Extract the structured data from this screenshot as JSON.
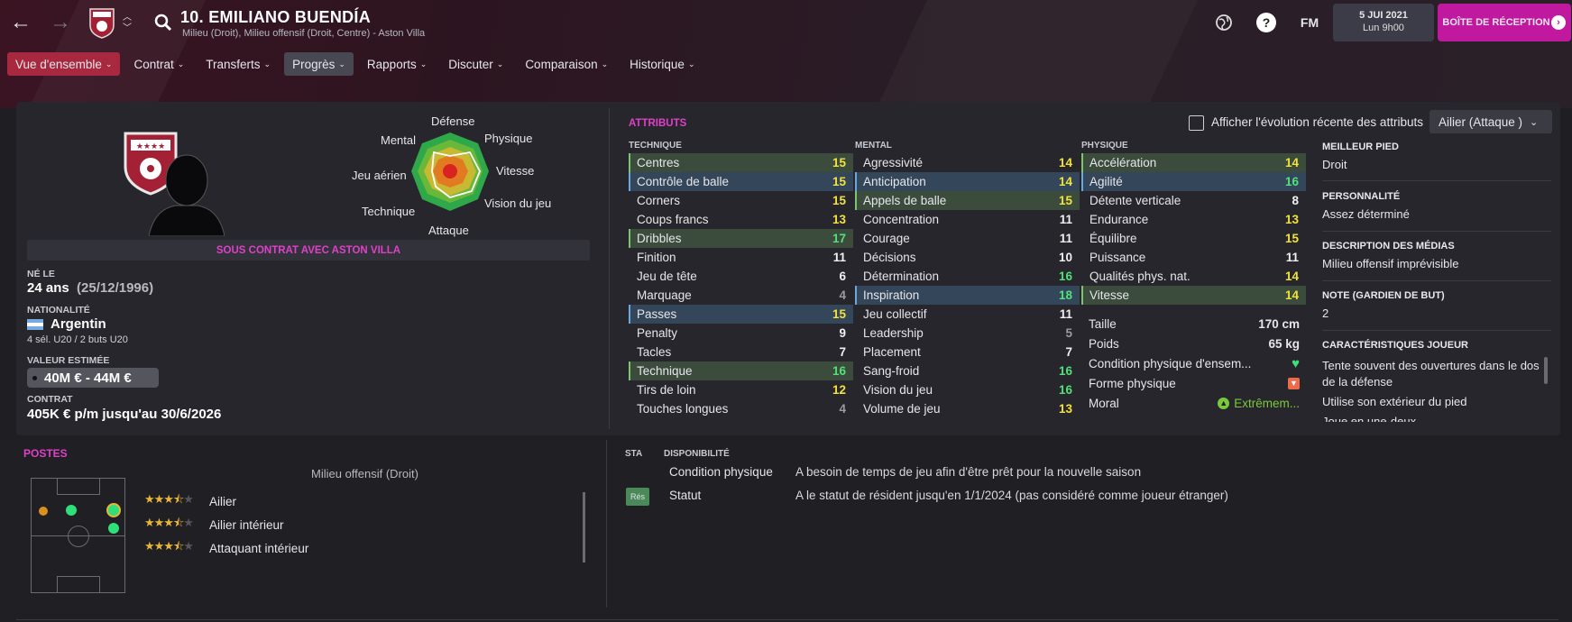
{
  "header": {
    "player_title": "10. EMILIANO BUENDÍA",
    "player_subtitle": "Milieu (Droit), Milieu offensif (Droit, Centre) - Aston Villa",
    "fm_label": "FM",
    "date": "5 JUI 2021",
    "time": "Lun 9h00",
    "inbox_label": "BOÎTE DE RÉCEPTION",
    "help_label": "?"
  },
  "nav": {
    "tabs": [
      {
        "label": "Vue d'ensemble"
      },
      {
        "label": "Contrat"
      },
      {
        "label": "Transferts"
      },
      {
        "label": "Progrès"
      },
      {
        "label": "Rapports"
      },
      {
        "label": "Discuter"
      },
      {
        "label": "Comparaison"
      },
      {
        "label": "Historique"
      }
    ]
  },
  "radar": {
    "labels": [
      "Défense",
      "Physique",
      "Vitesse",
      "Vision du jeu",
      "Attaque",
      "Technique",
      "Jeu aérien",
      "Mental"
    ]
  },
  "profile": {
    "contract_banner": "SOUS CONTRAT AVEC ASTON VILLA",
    "born_label": "NÉ LE",
    "age": "24 ans",
    "dob": "(25/12/1996)",
    "nationality_label": "NATIONALITÉ",
    "nationality": "Argentin",
    "caps": "4 sél. U20 / 2 buts U20",
    "value_label": "VALEUR ESTIMÉE",
    "value": "40M € - 44M €",
    "contract_label": "CONTRAT",
    "contract": "405K € p/m jusqu'au 30/6/2026"
  },
  "attributes": {
    "title": "ATTRIBUTS",
    "show_evolution_label": "Afficher l'évolution récente des attributs",
    "role_select": "Ailier (Attaque )",
    "technique_head": "TECHNIQUE",
    "mental_head": "MENTAL",
    "physique_head": "PHYSIQUE",
    "technique": [
      {
        "name": "Centres",
        "value": "15",
        "hl": "green"
      },
      {
        "name": "Contrôle de balle",
        "value": "15",
        "hl": "blue"
      },
      {
        "name": "Corners",
        "value": "15",
        "hl": ""
      },
      {
        "name": "Coups francs",
        "value": "13",
        "hl": ""
      },
      {
        "name": "Dribbles",
        "value": "17",
        "hl": "green"
      },
      {
        "name": "Finition",
        "value": "11",
        "hl": ""
      },
      {
        "name": "Jeu de tête",
        "value": "6",
        "hl": ""
      },
      {
        "name": "Marquage",
        "value": "4",
        "hl": ""
      },
      {
        "name": "Passes",
        "value": "15",
        "hl": "blue"
      },
      {
        "name": "Penalty",
        "value": "9",
        "hl": ""
      },
      {
        "name": "Tacles",
        "value": "7",
        "hl": ""
      },
      {
        "name": "Technique",
        "value": "16",
        "hl": "green"
      },
      {
        "name": "Tirs de loin",
        "value": "12",
        "hl": ""
      },
      {
        "name": "Touches longues",
        "value": "4",
        "hl": ""
      }
    ],
    "mental": [
      {
        "name": "Agressivité",
        "value": "14",
        "hl": ""
      },
      {
        "name": "Anticipation",
        "value": "14",
        "hl": "blue"
      },
      {
        "name": "Appels de balle",
        "value": "15",
        "hl": "green"
      },
      {
        "name": "Concentration",
        "value": "11",
        "hl": ""
      },
      {
        "name": "Courage",
        "value": "11",
        "hl": ""
      },
      {
        "name": "Décisions",
        "value": "10",
        "hl": ""
      },
      {
        "name": "Détermination",
        "value": "16",
        "hl": ""
      },
      {
        "name": "Inspiration",
        "value": "18",
        "hl": "blue"
      },
      {
        "name": "Jeu collectif",
        "value": "11",
        "hl": ""
      },
      {
        "name": "Leadership",
        "value": "5",
        "hl": ""
      },
      {
        "name": "Placement",
        "value": "7",
        "hl": ""
      },
      {
        "name": "Sang-froid",
        "value": "16",
        "hl": ""
      },
      {
        "name": "Vision du jeu",
        "value": "16",
        "hl": ""
      },
      {
        "name": "Volume de jeu",
        "value": "13",
        "hl": ""
      }
    ],
    "physique": [
      {
        "name": "Accélération",
        "value": "14",
        "hl": "green"
      },
      {
        "name": "Agilité",
        "value": "16",
        "hl": "blue"
      },
      {
        "name": "Détente verticale",
        "value": "8",
        "hl": ""
      },
      {
        "name": "Endurance",
        "value": "13",
        "hl": ""
      },
      {
        "name": "Équilibre",
        "value": "15",
        "hl": ""
      },
      {
        "name": "Puissance",
        "value": "11",
        "hl": ""
      },
      {
        "name": "Qualités phys. nat.",
        "value": "14",
        "hl": ""
      },
      {
        "name": "Vitesse",
        "value": "14",
        "hl": "green"
      }
    ],
    "physical_info": {
      "height_label": "Taille",
      "height": "170 cm",
      "weight_label": "Poids",
      "weight": "65 kg",
      "condition_label": "Condition physique d'ensem...",
      "form_label": "Forme physique",
      "morale_label": "Moral",
      "morale": "Extrêmem..."
    }
  },
  "right_info": {
    "foot_label": "MEILLEUR PIED",
    "foot": "Droit",
    "personality_label": "PERSONNALITÉ",
    "personality": "Assez déterminé",
    "media_label": "DESCRIPTION DES MÉDIAS",
    "media": "Milieu offensif imprévisible",
    "gk_label": "NOTE (GARDIEN DE BUT)",
    "gk": "2",
    "traits_label": "CARACTÉRISTIQUES JOUEUR",
    "trait1a": "Tente souvent des ouvertures dans le dos",
    "trait1b": "de la défense",
    "trait2": "Utilise son extérieur du pied",
    "trait3": "Joue en une-deux"
  },
  "postes": {
    "title": "POSTES",
    "subtitle": "Milieu offensif (Droit)",
    "roles": [
      {
        "name": "Ailier",
        "stars": 3.5
      },
      {
        "name": "Ailier intérieur",
        "stars": 3.5
      },
      {
        "name": "Attaquant intérieur",
        "stars": 3.5
      }
    ]
  },
  "availability": {
    "sta_head": "STA",
    "dispo_head": "DISPONIBILITÉ",
    "rows": [
      {
        "label": "Condition physique",
        "value": "A besoin de temps de jeu afin d'être prêt pour la nouvelle saison"
      },
      {
        "label": "Statut",
        "value": "A le statut de résident jusqu'en 1/1/2024 (pas considéré comme joueur étranger)"
      }
    ],
    "badge": "Rés"
  },
  "colors": {
    "accent": "#e040c8",
    "active_tab": "#a8283f",
    "inbox": "#c0189e",
    "green_value": "#52e07a",
    "yellow_value": "#f2e23a"
  }
}
